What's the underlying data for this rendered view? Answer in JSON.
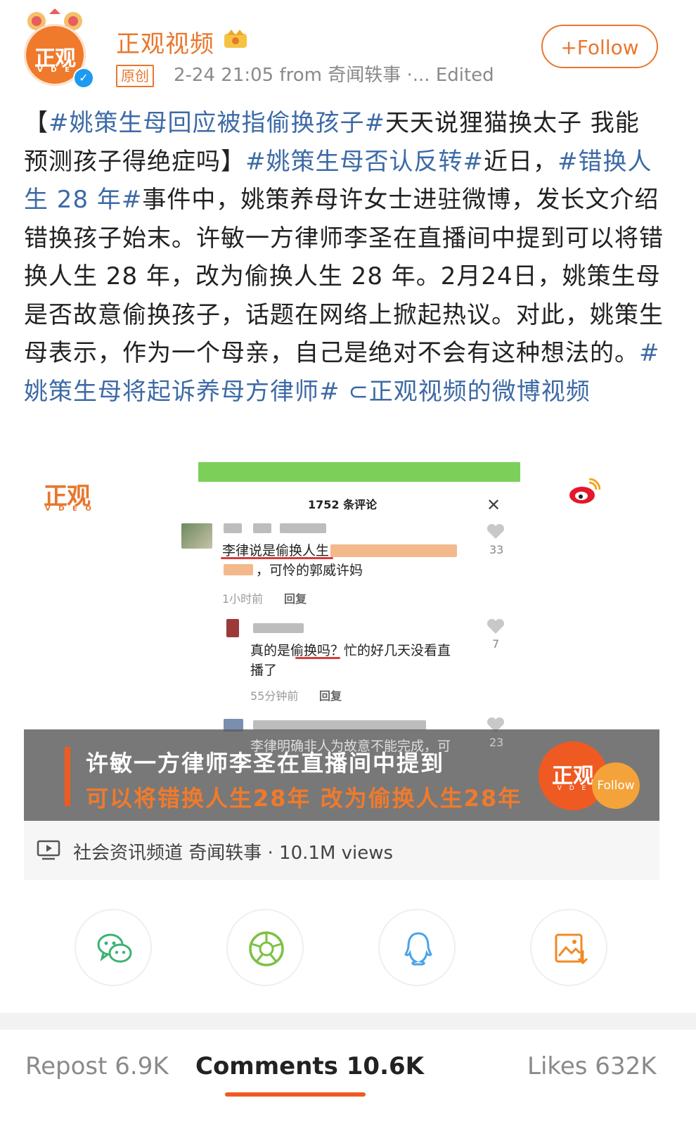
{
  "header": {
    "author": "正观视频",
    "original_badge": "原创",
    "meta": "2-24 21:05  from 奇闻轶事 ·... Edited",
    "follow_label": "+Follow",
    "accent_color": "#e8772e"
  },
  "post": {
    "segments": [
      {
        "type": "text",
        "text": "【"
      },
      {
        "type": "tag",
        "text": "#姚策生母回应被指偷换孩子#"
      },
      {
        "type": "text",
        "text": "天天说狸猫换太子 我能预测孩子得绝症吗】"
      },
      {
        "type": "tag",
        "text": "#姚策生母否认反转#"
      },
      {
        "type": "text",
        "text": "近日，"
      },
      {
        "type": "tag",
        "text": "#错换人生 28 年#"
      },
      {
        "type": "text",
        "text": "事件中，姚策养母许女士进驻微博，发长文介绍错换孩子始末。许敏一方律师李圣在直播间中提到可以将错换人生 28 年，改为偷换人生 28 年。2月24日，姚策生母是否故意偷换孩子，话题在网络上掀起热议。对此，姚策生母表示，作为一个母亲，自己是绝对不会有这种想法的。"
      },
      {
        "type": "tag",
        "text": "#姚策生母将起诉养母方律师#"
      },
      {
        "type": "text",
        "text": " "
      },
      {
        "type": "tag",
        "text": "⊂正观视频的微博视频"
      }
    ]
  },
  "video": {
    "watermark_logo": "正观",
    "watermark_sub": "V D E O",
    "comments_title": "1752 条评论",
    "close_glyph": "✕",
    "comments": [
      {
        "text": "李律说是偷换人生",
        "text2": "，可怜的郭威许妈",
        "time": "1小时前",
        "reply": "回复",
        "likes": "33"
      },
      {
        "text": "真的是偷换吗？忙的好几天没看直",
        "text2": "播了",
        "time": "55分钟前",
        "reply": "回复",
        "likes": "7"
      },
      {
        "text": "李律明确非人为故意不能完成，可",
        "likes": "23"
      }
    ],
    "caption_line1": "许敏一方律师李圣在直播间中提到",
    "caption_line2": "可以将错换人生28年 改为偷换人生28年",
    "round_logo": "正观",
    "round_sub": "V D E",
    "round_follow": "Follow",
    "info_text": "社会资讯频道 奇闻轶事 · 10.1M views"
  },
  "share": [
    "wechat-icon",
    "moments-icon",
    "qq-icon",
    "save-image-icon"
  ],
  "tabs": {
    "repost": "Repost 6.9K",
    "comments": "Comments 10.6K",
    "likes": "Likes 632K"
  }
}
